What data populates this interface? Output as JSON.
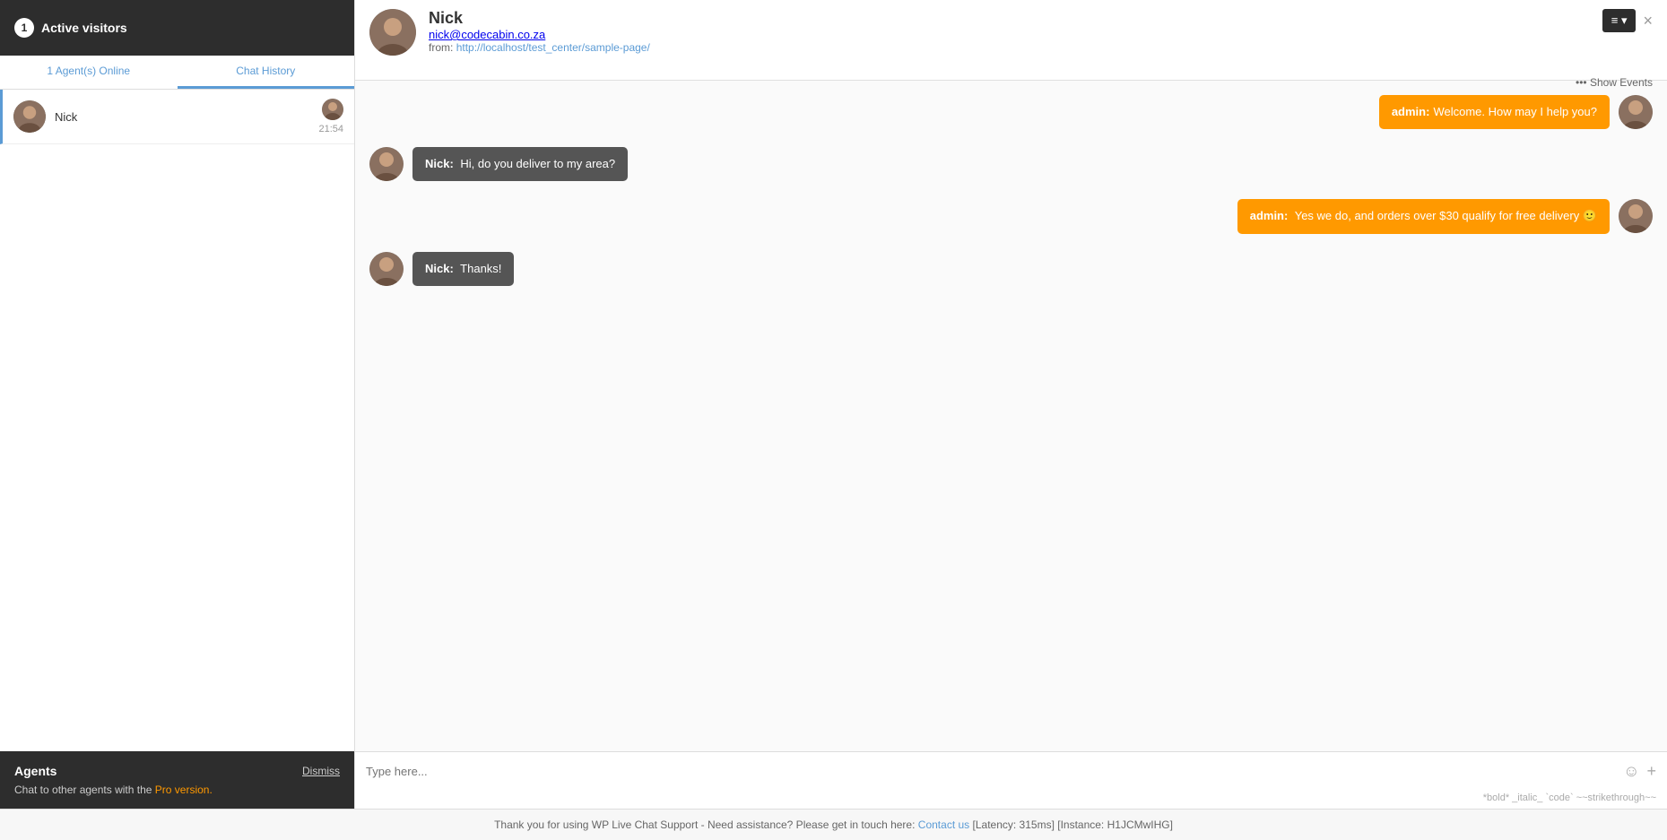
{
  "sidebar": {
    "active_visitors_label": "Active visitors",
    "active_count": "1",
    "tabs": [
      {
        "id": "agents-online",
        "label": "1 Agent(s) Online"
      },
      {
        "id": "chat-history",
        "label": "Chat History"
      }
    ],
    "chat_list": [
      {
        "name": "Nick",
        "time": "21:54"
      }
    ],
    "agents": {
      "title": "Agents",
      "dismiss_label": "Dismiss",
      "description": "Chat to other agents with the",
      "pro_label": "Pro version.",
      "pro_url": "#"
    }
  },
  "chat_header": {
    "name": "Nick",
    "email": "nick@codecabin.co.za",
    "from_label": "from:",
    "from_url": "http://localhost/test_center/sample-page/",
    "menu_button_label": "≡ ▾",
    "close_button": "×",
    "show_events_label": "••• Show Events"
  },
  "messages": [
    {
      "direction": "outgoing",
      "sender": "admin:",
      "text": "Welcome. How may I help you?"
    },
    {
      "direction": "incoming",
      "sender": "Nick:",
      "text": " Hi, do you deliver to my area?"
    },
    {
      "direction": "outgoing",
      "sender": "admin:",
      "text": " Yes we do, and orders over $30 qualify for free delivery 🙂"
    },
    {
      "direction": "incoming",
      "sender": "Nick:",
      "text": " Thanks!"
    }
  ],
  "input": {
    "placeholder": "Type here...",
    "toolbar_hint": "*bold* _italic_ `code` ~~strikethrough~~",
    "emoji_icon": "☺",
    "add_icon": "+"
  },
  "footer": {
    "text": "Thank you for using WP Live Chat Support - Need assistance? Please get in touch here:",
    "contact_label": "Contact us",
    "contact_url": "#",
    "latency_info": "[Latency: 315ms] [Instance: H1JCMwIHG]"
  }
}
